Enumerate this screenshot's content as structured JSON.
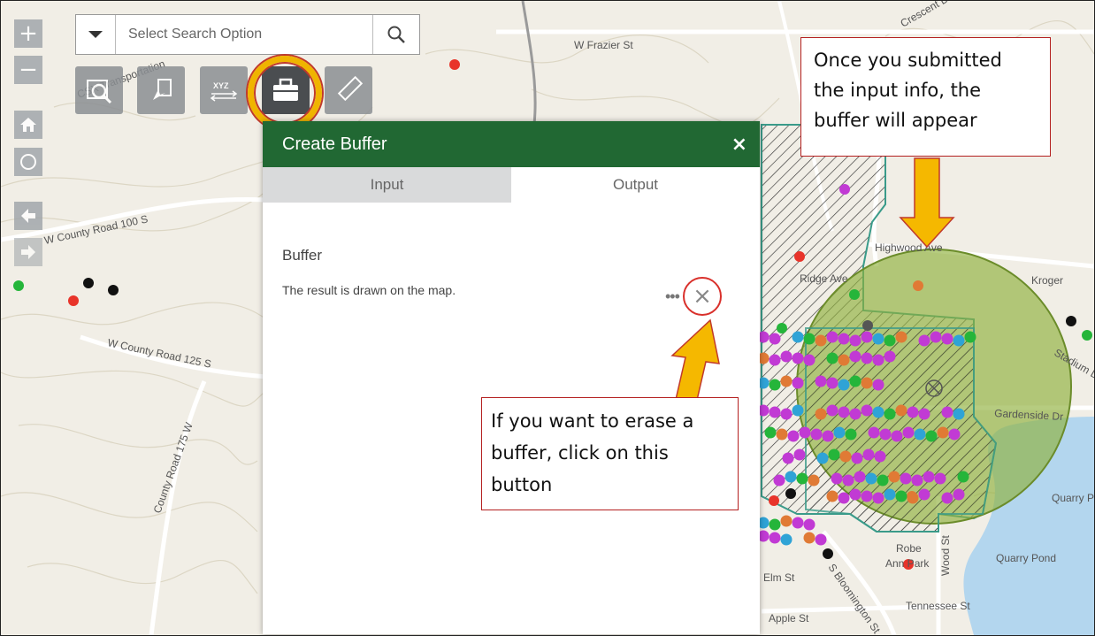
{
  "map": {
    "road_labels": [
      "W Frazier St",
      "W County Road 100 S",
      "W County Road 125 S",
      "County Road 175 W",
      "Highwood Ave",
      "Ridge Ave",
      "Kroger",
      "Gardenside Dr",
      "Quarry Pond",
      "Robe Ann Park",
      "Robe Ann Park",
      "Elm St",
      "Wood St",
      "S Bloomington St",
      "Tennessee St",
      "Apple St",
      "Crescent Dr",
      "CSX Transportation",
      "Stadium Dr",
      "Quarry P"
    ],
    "buffer_color": "#8fb13c"
  },
  "nav": {
    "zoom_in": "+",
    "zoom_out": "−",
    "home_icon": "home-icon",
    "locate_icon": "locate-icon",
    "back_icon": "arrow-left-icon",
    "forward_icon": "arrow-right-icon"
  },
  "search": {
    "placeholder": "Select Search Option"
  },
  "toolbar": {
    "tools": [
      {
        "name": "search-map-icon"
      },
      {
        "name": "identify-icon"
      },
      {
        "name": "xyz-icon",
        "label": "XYZ"
      },
      {
        "name": "toolbox-icon"
      },
      {
        "name": "measure-icon"
      }
    ],
    "highlight_color": "#f0b400"
  },
  "panel": {
    "title": "Create Buffer",
    "close": "×",
    "tabs": {
      "input": "Input",
      "output": "Output"
    },
    "result_title": "Buffer",
    "result_text": "The result is drawn on the map.",
    "more": "•••",
    "remove": "×",
    "header_color": "#216833"
  },
  "callouts": {
    "top": "Once you submitted the input info, the buffer will appear",
    "bottom": "If you want to erase a buffer, click on this button",
    "arrow_color": "#f5b800"
  }
}
